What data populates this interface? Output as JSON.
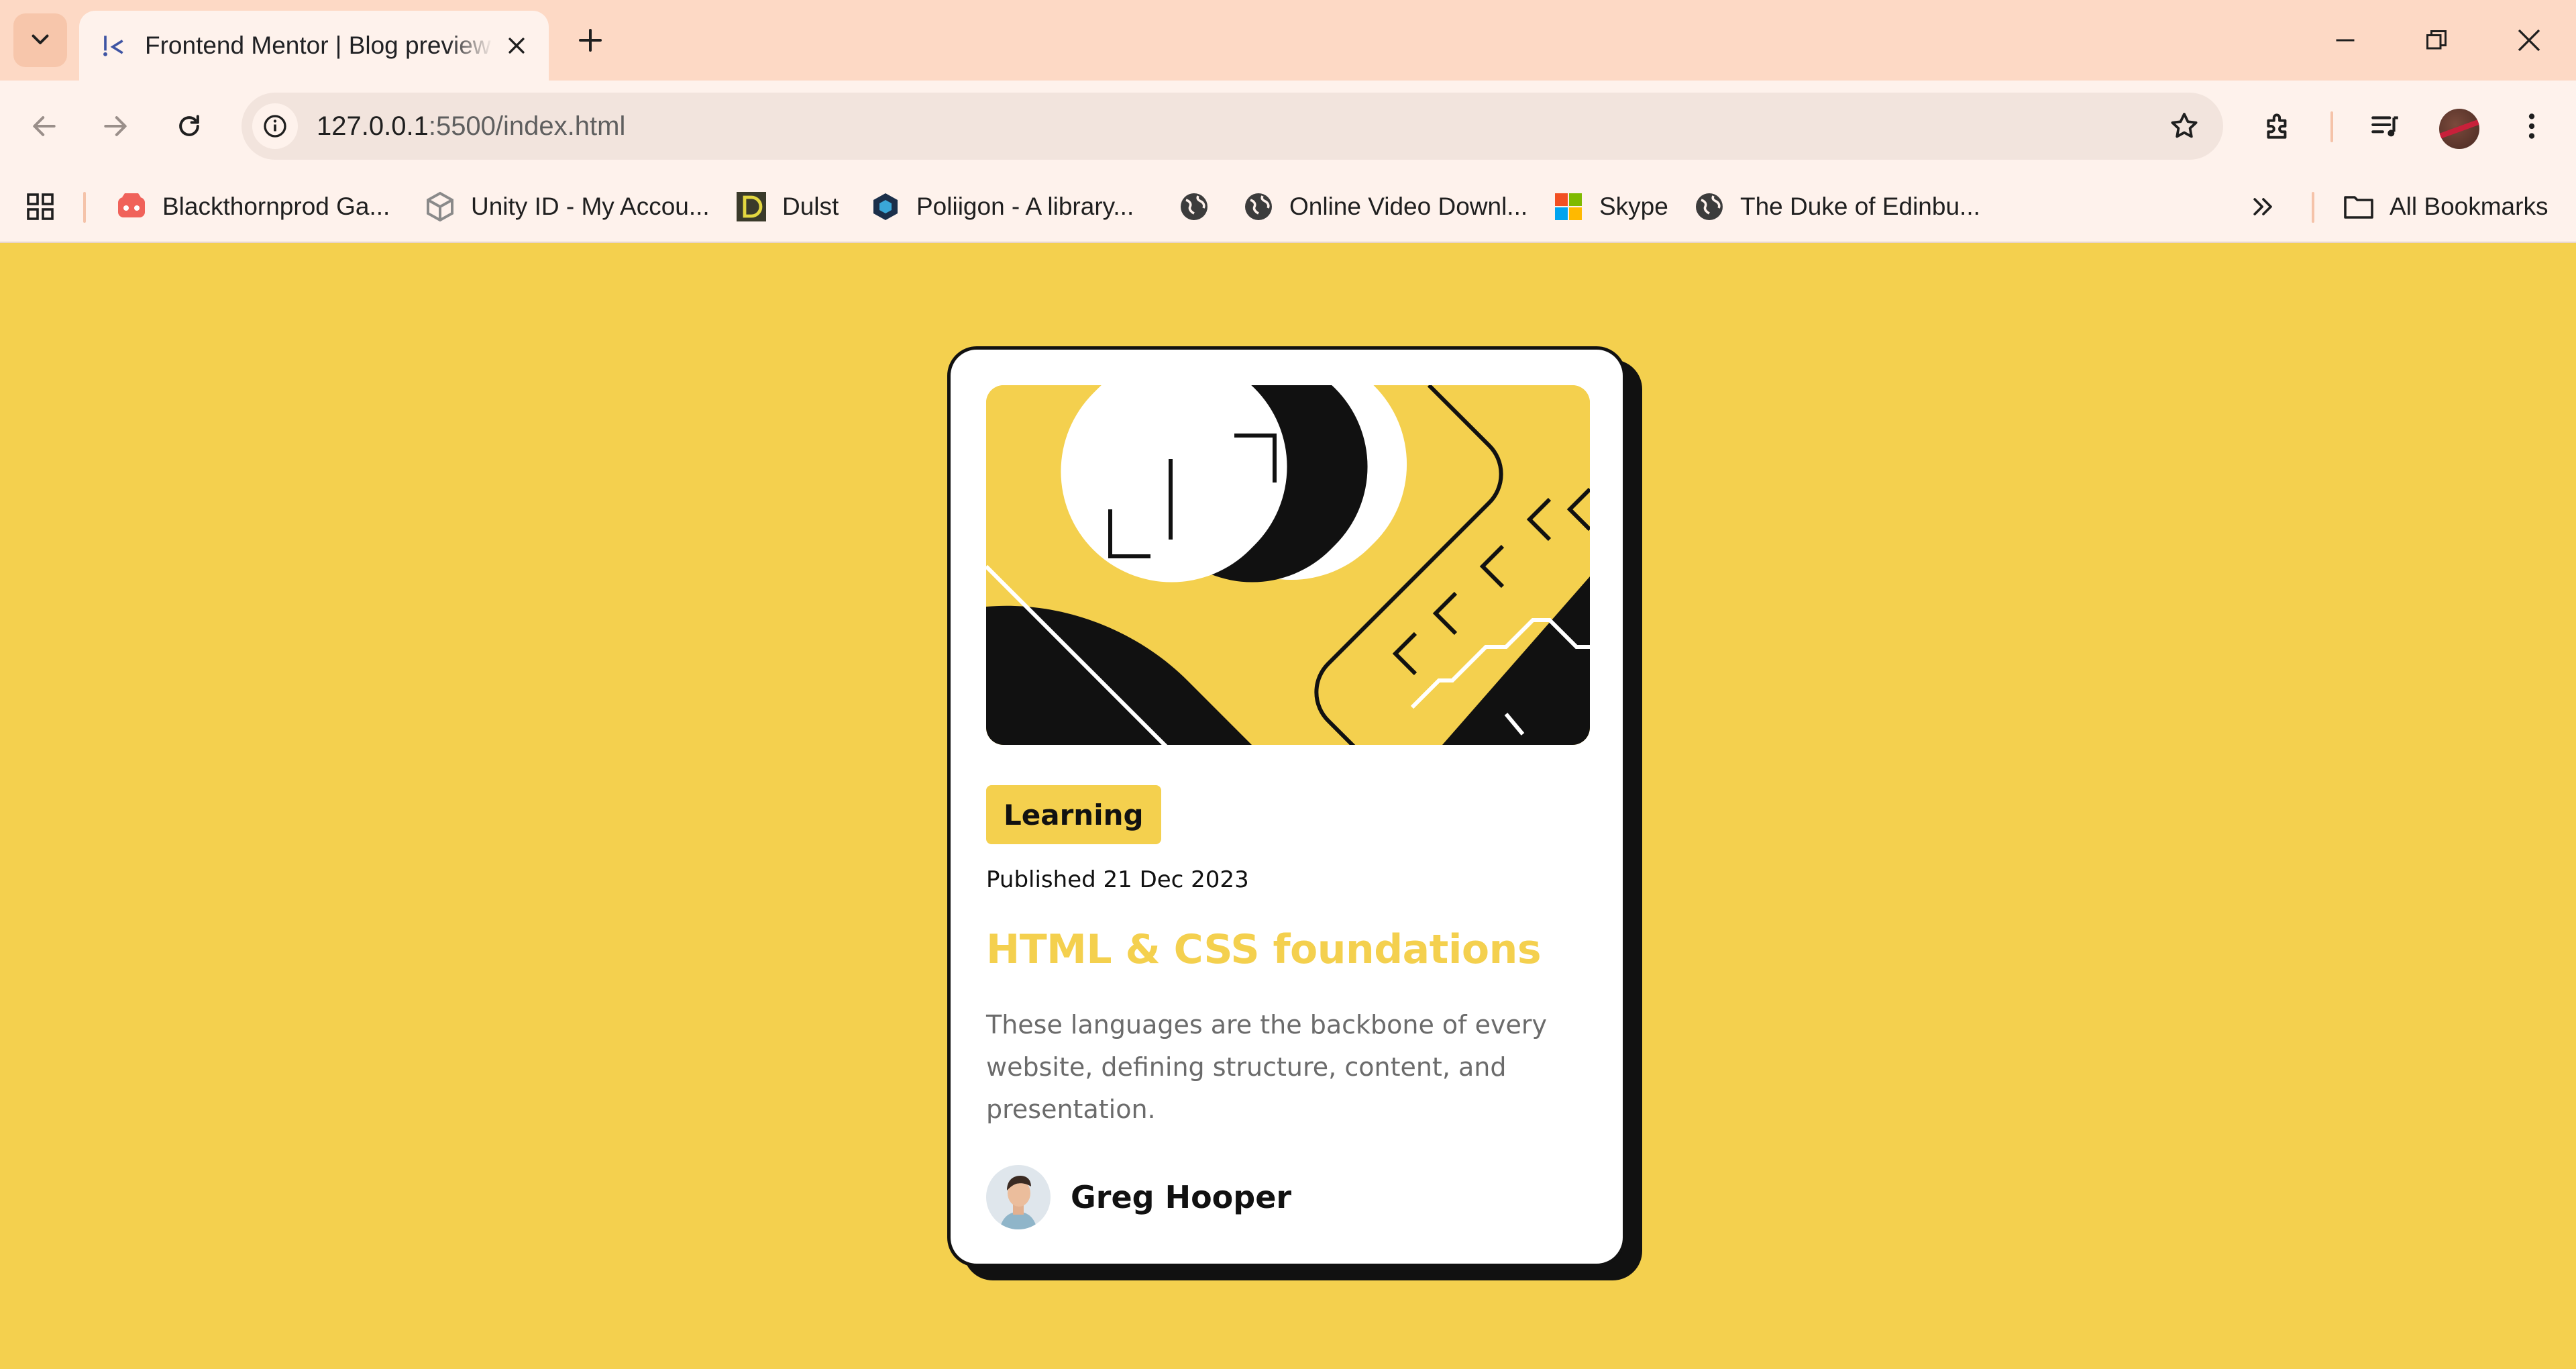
{
  "browser": {
    "tab": {
      "title": "Frontend Mentor | Blog preview card"
    },
    "address": {
      "host": "127.0.0.1",
      "path": ":5500/index.html"
    },
    "bookmarks": [
      {
        "label": "Blackthornprod Ga...",
        "icon": "gamepad-icon"
      },
      {
        "label": "Unity ID - My Accou...",
        "icon": "unity-icon"
      },
      {
        "label": "Dulst",
        "icon": "dulst-icon"
      },
      {
        "label": "Poliigon - A library...",
        "icon": "poliigon-icon"
      },
      {
        "label": "",
        "icon": "globe-icon"
      },
      {
        "label": "Online Video Downl...",
        "icon": "globe-icon"
      },
      {
        "label": "Skype",
        "icon": "windows-icon"
      },
      {
        "label": "The Duke of Edinbu...",
        "icon": "globe-icon"
      }
    ],
    "all_bookmarks_label": "All Bookmarks"
  },
  "card": {
    "category": "Learning",
    "published": "Published 21 Dec 2023",
    "title": "HTML & CSS foundations",
    "description": "These languages are the backbone of every website, defining structure, content, and presentation.",
    "author": "Greg Hooper"
  },
  "colors": {
    "page_background": "#f4d04e",
    "accent_yellow": "#f4d04e",
    "ink": "#111111",
    "muted_text": "#6b6b6b",
    "chrome_tabstrip": "#fdd9c5",
    "chrome_toolbar": "#fef2ec"
  }
}
